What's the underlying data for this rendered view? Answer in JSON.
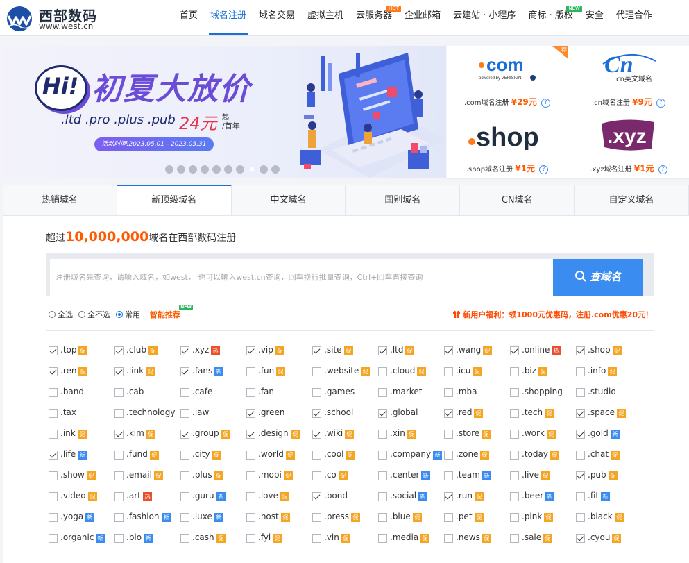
{
  "header": {
    "logo_cn": "西部数码",
    "logo_en": "www.west.cn",
    "nav": [
      {
        "label": "首页",
        "active": false,
        "badge": ""
      },
      {
        "label": "域名注册",
        "active": true,
        "badge": ""
      },
      {
        "label": "域名交易",
        "active": false,
        "badge": ""
      },
      {
        "label": "虚拟主机",
        "active": false,
        "badge": ""
      },
      {
        "label": "云服务器",
        "active": false,
        "badge": "HOT"
      },
      {
        "label": "企业邮箱",
        "active": false,
        "badge": ""
      },
      {
        "label": "云建站 · 小程序",
        "active": false,
        "badge": ""
      },
      {
        "label": "商标 · 版权",
        "active": false,
        "badge": "NEW"
      },
      {
        "label": "安全",
        "active": false,
        "badge": ""
      },
      {
        "label": "代理合作",
        "active": false,
        "badge": ""
      }
    ]
  },
  "banner": {
    "hi": "Hi!",
    "title": "初夏大放价",
    "tlds": ".ltd .pro .plus .pub",
    "price": "24元",
    "price_sup": "起",
    "price_sub": "/首年",
    "activity": "活动时间:2023.05.01 - 2023.05.31",
    "dots": 10,
    "active_dot": 7
  },
  "cards": [
    {
      "logo": ".com",
      "logo_sub": "powered by VERISIGN",
      "label": ".com域名注册",
      "price": "¥29元",
      "flag": "荐"
    },
    {
      "logo": "Cn",
      "logo_sub": ".cn英文域名",
      "label": ".cn域名注册",
      "price": "¥9元",
      "flag": ""
    },
    {
      "logo": ".shop",
      "logo_sub": "",
      "label": ".shop域名注册",
      "price": "¥1元",
      "flag": ""
    },
    {
      "logo": ".xyz",
      "logo_sub": "",
      "label": ".xyz域名注册",
      "price": "¥1元",
      "flag": ""
    }
  ],
  "tabs": [
    "热销域名",
    "新顶级域名",
    "中文域名",
    "国别域名",
    "CN域名",
    "自定义域名"
  ],
  "active_tab": 1,
  "intro": {
    "prefix": "超过",
    "count": "10,000,000",
    "suffix": "域名在西部数码注册"
  },
  "search": {
    "placeholder": "注册域名先查询，请输入域名，如west， 也可以输入west.cn查询，回车换行批量查询，Ctrl+回车直接查询",
    "button": "查域名"
  },
  "options": {
    "all": "全选",
    "none": "全不选",
    "common": "常用",
    "smart": "智能推荐",
    "smart_tag": "NEW",
    "promo": "新用户福利：领1000元优惠码，注册.com优惠20元！"
  },
  "tag_labels": {
    "cu": "促",
    "hot": "热",
    "new": "新"
  },
  "domains": [
    [
      ".top",
      1,
      "cu"
    ],
    [
      ".club",
      1,
      "cu"
    ],
    [
      ".xyz",
      1,
      "hot"
    ],
    [
      ".vip",
      1,
      "cu"
    ],
    [
      ".site",
      1,
      "cu"
    ],
    [
      ".ltd",
      1,
      "cu"
    ],
    [
      ".wang",
      1,
      "cu"
    ],
    [
      ".online",
      1,
      "hot"
    ],
    [
      ".shop",
      1,
      "cu"
    ],
    [
      ".ren",
      1,
      "cu"
    ],
    [
      ".link",
      1,
      "cu"
    ],
    [
      ".fans",
      1,
      "new"
    ],
    [
      ".fun",
      0,
      "cu"
    ],
    [
      ".website",
      0,
      "cu"
    ],
    [
      ".cloud",
      0,
      "cu"
    ],
    [
      ".icu",
      0,
      "cu"
    ],
    [
      ".biz",
      0,
      "cu"
    ],
    [
      ".info",
      0,
      "cu"
    ],
    [
      ".band",
      0,
      ""
    ],
    [
      ".cab",
      0,
      ""
    ],
    [
      ".cafe",
      0,
      ""
    ],
    [
      ".fan",
      0,
      ""
    ],
    [
      ".games",
      0,
      ""
    ],
    [
      ".market",
      0,
      ""
    ],
    [
      ".mba",
      0,
      ""
    ],
    [
      ".shopping",
      0,
      ""
    ],
    [
      ".studio",
      0,
      ""
    ],
    [
      ".tax",
      0,
      ""
    ],
    [
      ".technology",
      0,
      ""
    ],
    [
      ".law",
      0,
      ""
    ],
    [
      ".green",
      1,
      ""
    ],
    [
      ".school",
      1,
      ""
    ],
    [
      ".global",
      1,
      ""
    ],
    [
      ".red",
      1,
      "cu"
    ],
    [
      ".tech",
      0,
      "cu"
    ],
    [
      ".space",
      1,
      "cu"
    ],
    [
      ".ink",
      0,
      "cu"
    ],
    [
      ".kim",
      1,
      "cu"
    ],
    [
      ".group",
      1,
      "cu"
    ],
    [
      ".design",
      1,
      "cu"
    ],
    [
      ".wiki",
      1,
      "cu"
    ],
    [
      ".xin",
      0,
      "cu"
    ],
    [
      ".store",
      0,
      "cu"
    ],
    [
      ".work",
      0,
      "cu"
    ],
    [
      ".gold",
      1,
      "new"
    ],
    [
      ".life",
      1,
      "new"
    ],
    [
      ".fund",
      0,
      "cu"
    ],
    [
      ".city",
      0,
      "cu"
    ],
    [
      ".world",
      0,
      "cu"
    ],
    [
      ".cool",
      0,
      "cu"
    ],
    [
      ".company",
      0,
      "new"
    ],
    [
      ".zone",
      0,
      "cu"
    ],
    [
      ".today",
      0,
      "cu"
    ],
    [
      ".chat",
      0,
      "cu"
    ],
    [
      ".show",
      0,
      "cu"
    ],
    [
      ".email",
      0,
      "cu"
    ],
    [
      ".plus",
      0,
      "cu"
    ],
    [
      ".mobi",
      0,
      "cu"
    ],
    [
      ".co",
      0,
      "cu"
    ],
    [
      ".center",
      0,
      "new"
    ],
    [
      ".team",
      0,
      "new"
    ],
    [
      ".live",
      0,
      "cu"
    ],
    [
      ".pub",
      1,
      "cu"
    ],
    [
      ".video",
      0,
      "cu"
    ],
    [
      ".art",
      0,
      "hot"
    ],
    [
      ".guru",
      0,
      "new"
    ],
    [
      ".love",
      0,
      "cu"
    ],
    [
      ".bond",
      1,
      ""
    ],
    [
      ".social",
      0,
      "new"
    ],
    [
      ".run",
      1,
      "cu"
    ],
    [
      ".beer",
      0,
      "new"
    ],
    [
      ".fit",
      0,
      "new"
    ],
    [
      ".yoga",
      0,
      "new"
    ],
    [
      ".fashion",
      0,
      "new"
    ],
    [
      ".luxe",
      0,
      "new"
    ],
    [
      ".host",
      0,
      "cu"
    ],
    [
      ".press",
      0,
      "cu"
    ],
    [
      ".blue",
      0,
      "cu"
    ],
    [
      ".pet",
      0,
      "cu"
    ],
    [
      ".pink",
      0,
      "cu"
    ],
    [
      ".black",
      0,
      "cu"
    ],
    [
      ".organic",
      0,
      "new"
    ],
    [
      ".bio",
      0,
      "new"
    ],
    [
      ".cash",
      0,
      "cu"
    ],
    [
      ".fyi",
      0,
      "cu"
    ],
    [
      ".vin",
      0,
      "cu"
    ],
    [
      ".media",
      0,
      "cu"
    ],
    [
      ".news",
      0,
      "cu"
    ],
    [
      ".sale",
      0,
      "cu"
    ],
    [
      ".cyou",
      1,
      "cu"
    ]
  ]
}
